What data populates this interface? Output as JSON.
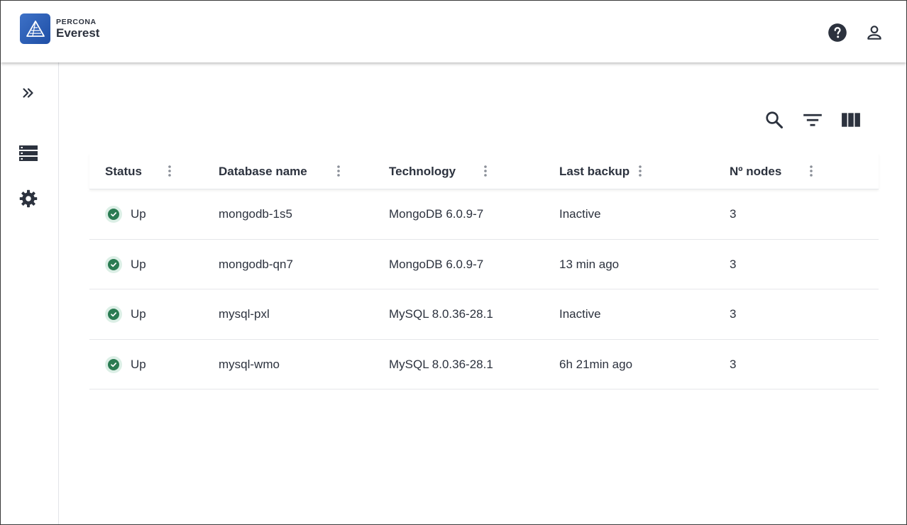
{
  "header": {
    "brand": "PERCONA",
    "product": "Everest",
    "icons": [
      "help-icon",
      "user-icon"
    ]
  },
  "sidebar": {
    "items": [
      {
        "icon": "expand-chevrons-icon"
      },
      {
        "icon": "database-list-icon"
      },
      {
        "icon": "settings-gear-icon"
      }
    ]
  },
  "toolbar": {
    "icons": [
      "search-icon",
      "filter-icon",
      "columns-icon"
    ]
  },
  "table": {
    "columns": [
      "Status",
      "Database name",
      "Technology",
      "Last backup",
      "Nº nodes"
    ],
    "rows": [
      {
        "status": "Up",
        "name": "mongodb-1s5",
        "technology": "MongoDB 6.0.9-7",
        "last_backup": "Inactive",
        "nodes": "3"
      },
      {
        "status": "Up",
        "name": "mongodb-qn7",
        "technology": "MongoDB 6.0.9-7",
        "last_backup": "13 min ago",
        "nodes": "3"
      },
      {
        "status": "Up",
        "name": "mysql-pxl",
        "technology": "MySQL 8.0.36-28.1",
        "last_backup": "Inactive",
        "nodes": "3"
      },
      {
        "status": "Up",
        "name": "mysql-wmo",
        "technology": "MySQL 8.0.36-28.1",
        "last_backup": "6h 21min ago",
        "nodes": "3"
      }
    ]
  },
  "colors": {
    "brand_blue": "#2b5fb8",
    "status_green": "#2b7b52",
    "text": "#2c323e"
  }
}
